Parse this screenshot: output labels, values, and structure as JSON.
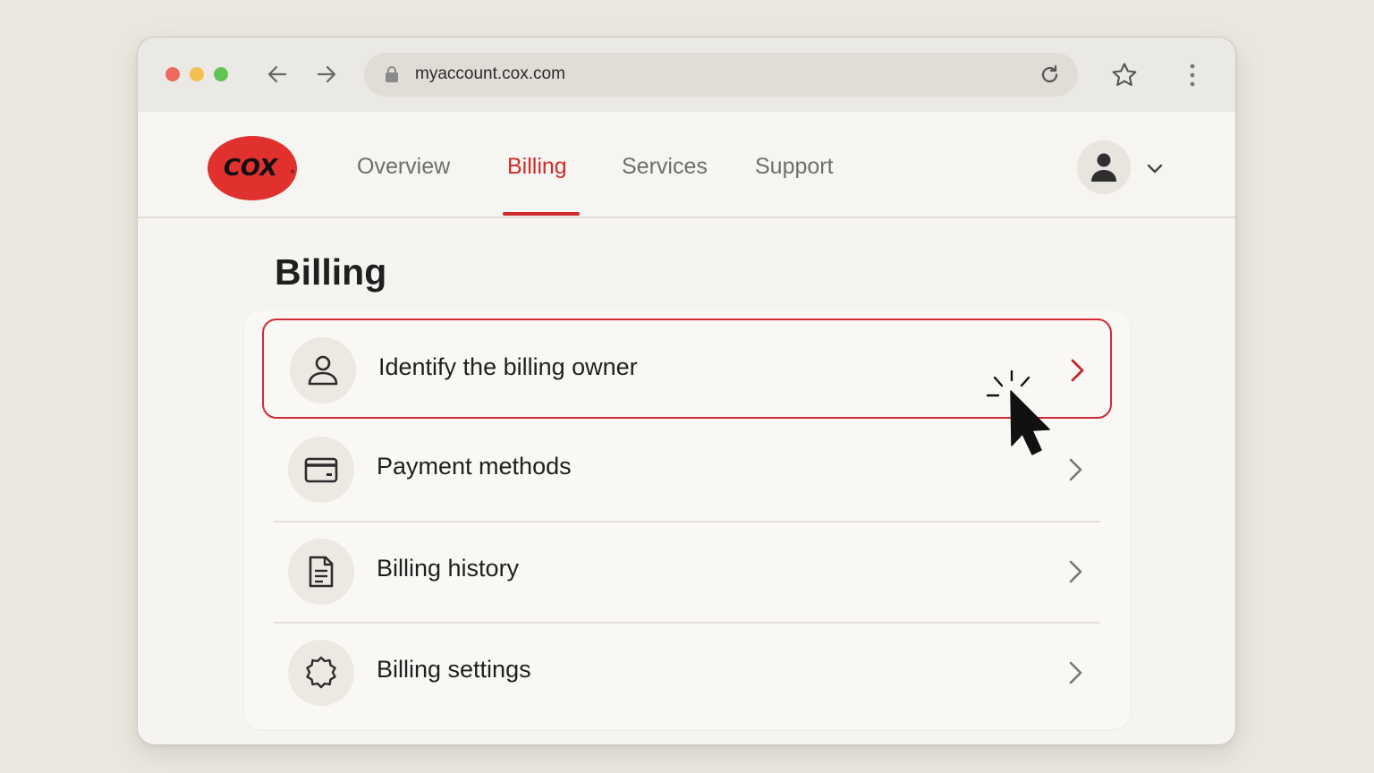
{
  "browser": {
    "url": "myaccount.cox.com",
    "icons": {
      "back": "back-arrow-icon",
      "forward": "forward-arrow-icon",
      "lock": "lock-icon",
      "reload": "reload-icon",
      "bookmark": "star-icon",
      "menu": "kebab-menu-icon"
    }
  },
  "header": {
    "logo_text": "COX",
    "nav": [
      {
        "label": "Overview",
        "active": false
      },
      {
        "label": "Billing",
        "active": true
      },
      {
        "label": "Services",
        "active": false
      },
      {
        "label": "Support",
        "active": false
      }
    ],
    "account_icon": "user-avatar-icon"
  },
  "main": {
    "title": "Billing",
    "items": [
      {
        "label": "Identify the billing owner",
        "icon": "person-icon",
        "highlighted": true
      },
      {
        "label": "Payment methods",
        "icon": "credit-card-icon",
        "highlighted": false
      },
      {
        "label": "Billing history",
        "icon": "document-icon",
        "highlighted": false
      },
      {
        "label": "Billing settings",
        "icon": "gear-icon",
        "highlighted": false
      }
    ]
  },
  "colors": {
    "accent": "#d02a2a",
    "brand": "#e0312e",
    "background": "#ebe7de"
  }
}
